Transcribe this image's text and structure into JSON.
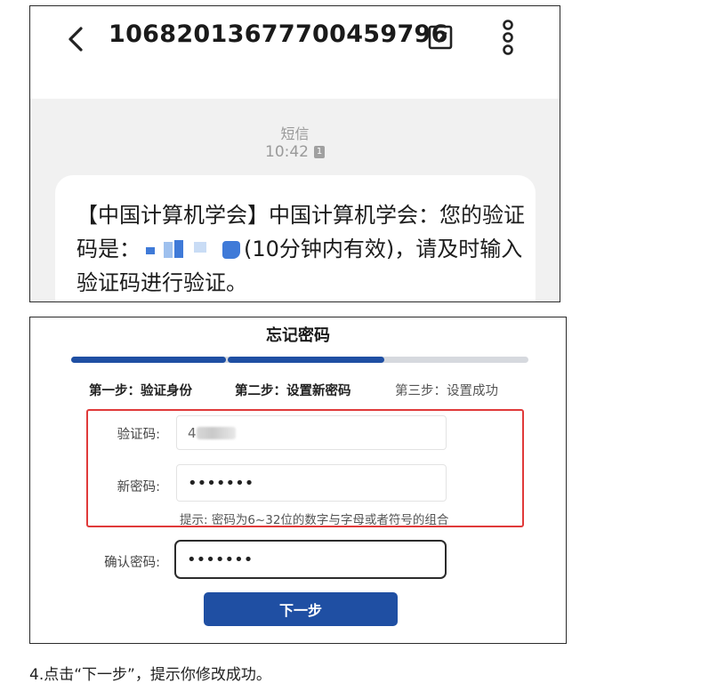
{
  "sms": {
    "sender_number": "10682013677700459796",
    "channel_label": "短信",
    "time": "10:42",
    "sim_badge": "1",
    "message_part1": "【中国计算机学会】中国计算机学会：您的验证码是：",
    "message_part2": "(10分钟内有效)，请及时输入验证码进行验证。",
    "icons": [
      "back-arrow-icon",
      "checkbox-icon",
      "more-vertical-icon"
    ]
  },
  "form": {
    "title": "忘记密码",
    "progress": {
      "completed_steps": 2,
      "total_steps": 3
    },
    "steps": [
      "第一步：验证身份",
      "第二步：设置新密码",
      "第三步：设置成功"
    ],
    "fields": {
      "code_label": "验证码:",
      "code_value_prefix": "4",
      "password_label": "新密码:",
      "password_value": "•••••••",
      "hint": "提示: 密码为6~32位的数字与字母或者符号的组合",
      "confirm_label": "确认密码:",
      "confirm_value": "•••••••"
    },
    "next_button": "下一步",
    "colors": {
      "primary": "#1f4fa3",
      "highlight": "#e03a3a",
      "track": "#d6d9de"
    }
  },
  "caption": "4.点击“下一步”，提示你修改成功。"
}
